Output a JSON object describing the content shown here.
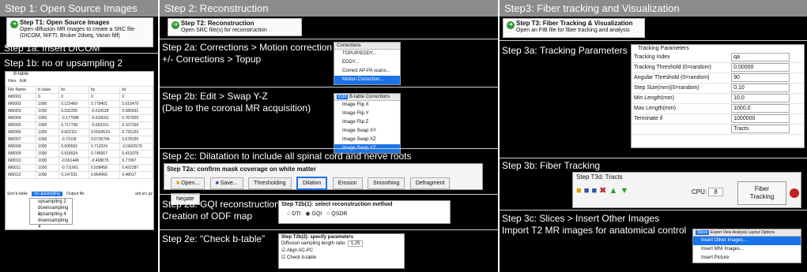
{
  "col1": {
    "header": "Step 1: Open Source Images",
    "t1_title": "Step T1: Open Source Images",
    "t1_desc": "Open diffusion MR images to create a SRC file (DICOM, NIFTI, Bruker 2dseq, Varan fdf)",
    "step1a": "Step 1a: Insert DICOM",
    "step1b": "Step 1b: no or upsampling 2",
    "btable_title": "B-table",
    "btable_menu": [
      "Files",
      "Edit"
    ],
    "btable_headers": [
      "File Name",
      "b value",
      "bx",
      "by",
      "bz"
    ],
    "btable_rows": [
      [
        "IM0001",
        "0",
        "0",
        "0",
        "0"
      ],
      [
        "IM0002",
        "1000",
        "0.122469",
        "0.778401",
        "0.615479"
      ],
      [
        "IM0003",
        "1000",
        "0.532255",
        "-0.615628",
        "0.580931"
      ],
      [
        "IM0004",
        "1000",
        "-0.177088",
        "-0.615662",
        "0.767825"
      ],
      [
        "IM0005",
        "1000",
        "0.717738",
        "-0.692151",
        "0.107329"
      ],
      [
        "IM0006",
        "1000",
        "0.662111",
        "0.0934519",
        "0.725153"
      ],
      [
        "IM0007",
        "1000",
        "-0.73118",
        "0.0735784",
        "0.678335"
      ],
      [
        "IM0008",
        "1000",
        "0.699563",
        "0.712024",
        "-0.0602579"
      ],
      [
        "IM0009",
        "1000",
        "0.918924",
        "0.745667",
        "0.419378"
      ],
      [
        "IM0010",
        "1000",
        "-0.561448",
        "-0.408675",
        "0.77967"
      ],
      [
        "IM0011",
        "1000",
        "-0.711661",
        "0.558458",
        "0.422287"
      ],
      [
        "IM0012",
        "1000",
        "0.147031",
        "0.864066",
        "0.48017"
      ]
    ],
    "sort_label": "Sort b-table",
    "upsample_options": [
      "no upsampling",
      "upsampling 2",
      "downsampling 2",
      "upsampling 4",
      "downsampling 4"
    ],
    "output_label": "Output file",
    "output_suffix": "ard.src.gz"
  },
  "col2": {
    "header": "Step 2: Reconstruction",
    "t2_title": "Step T2: Reconstruction",
    "t2_desc": "Open SRC file(s) for reconstruction",
    "step2a_line1": "Step 2a: Corrections > Motion correction",
    "step2a_line2": "+/- Corrections > Topup",
    "corr_menu_title": "Corrections",
    "corr_items": [
      "TOPUP/EDDY...",
      "EDDY...",
      "Correct AP-PA scans...",
      "Motion Correction..."
    ],
    "step2b_line1": "Step 2b: Edit > Swap Y-Z",
    "step2b_line2": "(Due to the coronal MR acquisition)",
    "edit_menu_bar": [
      "Edit",
      "B-table",
      "Corrections"
    ],
    "edit_items": [
      "Image Flip X",
      "Image Flip Y",
      "Image Flip Z",
      "Image Swap XY",
      "Image Swap XZ",
      "Image Swap YZ"
    ],
    "step2c": "Step 2c: Dilatation to include all spinal cord and nerve roots",
    "t2a_title": "Step T2a: confirm mask coverage on white matter",
    "t2a_buttons": [
      "Open...",
      "Save...",
      "Thresholding",
      "Dilation",
      "Erosion",
      "Smoothing",
      "Defragment",
      "Negate"
    ],
    "step2d_line1": "Step 2d: GQI reconstruction",
    "step2d_line2": "Creation of ODF map",
    "t2b1_title": "Step T2b(1): select reconstruction method",
    "recon_methods": [
      "DTI",
      "GQI",
      "QSDR"
    ],
    "step2e": "Step 2e: “Check b-table”",
    "t2b2_title": "Step T2b(2): specify parameters",
    "dsl_label": "Diffusion sampling length ratio:",
    "dsl_value": "1,25",
    "align_label": "Align AC-PC",
    "check_btable_label": "Check b-table"
  },
  "col3": {
    "header": "Step3: Fiber tracking and Visualization",
    "t3_title": "Step T3: Fiber Tracking & Visualization",
    "t3_desc": "Open an FIB file for fiber tracking and analysis",
    "step3a": "Step 3a: Tracking Parameters",
    "tp_title": "Tracking Parameters",
    "params": [
      {
        "label": "Tracking Index",
        "value": "qa"
      },
      {
        "label": "Tracking Threshold (0=random)",
        "value": "0,00000"
      },
      {
        "label": "Angular Threshold (0=random)",
        "value": "90"
      },
      {
        "label": "Step Size(mm)(0=random)",
        "value": "0,10"
      },
      {
        "label": "Min Length(mm)",
        "value": "10,0"
      },
      {
        "label": "Max Length(mm)",
        "value": "1000,0"
      },
      {
        "label": "Terminate if",
        "value": "1000000"
      },
      {
        "label": "",
        "value": "Tracts"
      }
    ],
    "step3b": "Step 3b: Fiber Tracking",
    "t3d_title": "Step T3d: Tracts",
    "cpu_label": "CPU:",
    "cpu_value": "8",
    "fiber_btn_line1": "Fiber",
    "fiber_btn_line2": "Tracking",
    "step3c_line1": "Step 3c: Slices > Insert Other Images",
    "step3c_line2": "Import T2 MR images for anatomical control",
    "slices_menu_bar": [
      "Slices",
      "Export",
      "View",
      "Analysis",
      "Layout",
      "Options"
    ],
    "slices_items": [
      "Insert Other Images...",
      "Insert MNI Images...",
      "Insert Picture"
    ]
  },
  "colors": {
    "header_gray": "#8c8c8c",
    "select_blue": "#1a73e8",
    "panel_black": "#000000"
  }
}
